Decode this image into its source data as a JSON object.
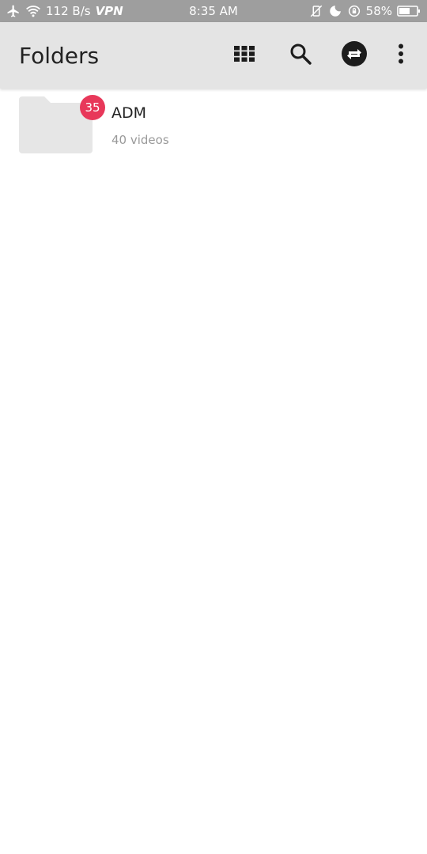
{
  "status_bar": {
    "network_speed": "112 B/s",
    "vpn": "VPN",
    "time": "8:35 AM",
    "battery": "58%",
    "icons": [
      "airplane-icon",
      "wifi-icon",
      "vibrate-off-icon",
      "do-not-disturb-moon-icon",
      "rotation-lock-icon",
      "battery-icon"
    ]
  },
  "app_bar": {
    "title": "Folders",
    "actions": [
      "grid-view-icon",
      "search-icon",
      "transfer-icon",
      "more-vert-icon"
    ]
  },
  "folders": [
    {
      "name": "ADM",
      "count": "40 videos",
      "badge": "35"
    }
  ],
  "colors": {
    "status_bar_bg": "#9e9e9e",
    "app_bar_bg": "#e4e4e4",
    "badge": "#e8385a",
    "folder_icon": "#e6e6e6"
  }
}
